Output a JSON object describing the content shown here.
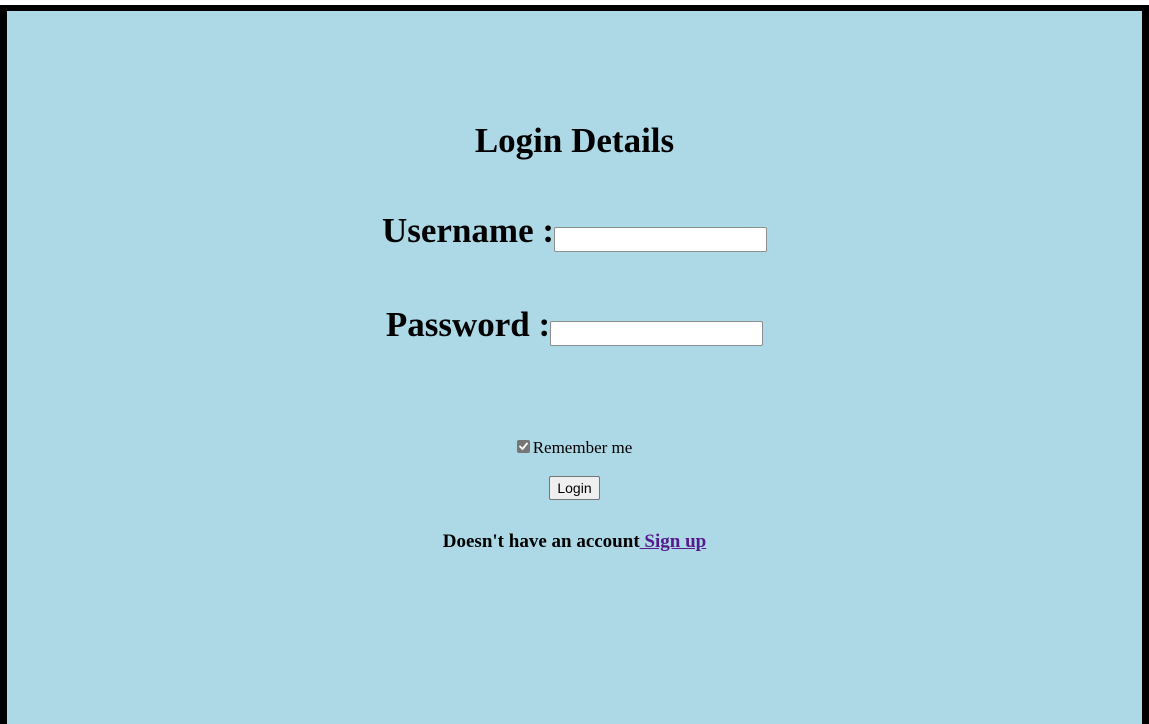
{
  "form": {
    "title": "Login Details",
    "username_label": "Username :",
    "username_value": "",
    "password_label": "Password :",
    "password_value": "",
    "remember_label": "Remember me",
    "remember_checked": true,
    "login_button": "Login",
    "signup_prompt": "Doesn't have an account",
    "signup_link": " Sign up"
  },
  "colors": {
    "background": "#add8e6",
    "border": "#000000",
    "link": "#551a8b"
  }
}
